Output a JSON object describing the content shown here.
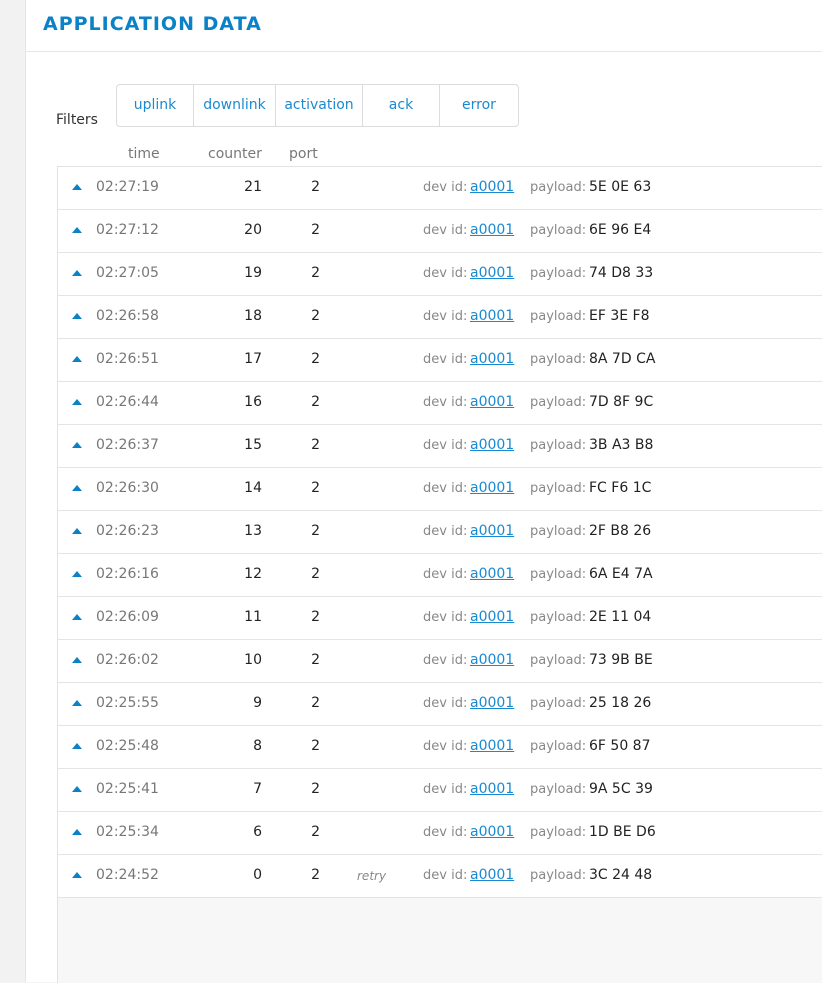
{
  "header": {
    "title": "APPLICATION DATA"
  },
  "filters": {
    "label": "Filters",
    "buttons": [
      {
        "label": "uplink"
      },
      {
        "label": "downlink"
      },
      {
        "label": "activation"
      },
      {
        "label": "ack"
      },
      {
        "label": "error"
      }
    ]
  },
  "columns": {
    "time": "time",
    "counter": "counter",
    "port": "port"
  },
  "labels": {
    "dev_id": "dev id:",
    "payload": "payload:"
  },
  "colors": {
    "accent": "#0b82c8",
    "link": "#1a8ad0"
  },
  "icons": {
    "direction": "uplink-arrow-icon"
  },
  "rows": [
    {
      "time": "02:27:19",
      "counter": "21",
      "port": "2",
      "flag": "",
      "dev_id": "a0001",
      "payload": "5E 0E 63"
    },
    {
      "time": "02:27:12",
      "counter": "20",
      "port": "2",
      "flag": "",
      "dev_id": "a0001",
      "payload": "6E 96 E4"
    },
    {
      "time": "02:27:05",
      "counter": "19",
      "port": "2",
      "flag": "",
      "dev_id": "a0001",
      "payload": "74 D8 33"
    },
    {
      "time": "02:26:58",
      "counter": "18",
      "port": "2",
      "flag": "",
      "dev_id": "a0001",
      "payload": "EF 3E F8"
    },
    {
      "time": "02:26:51",
      "counter": "17",
      "port": "2",
      "flag": "",
      "dev_id": "a0001",
      "payload": "8A 7D CA"
    },
    {
      "time": "02:26:44",
      "counter": "16",
      "port": "2",
      "flag": "",
      "dev_id": "a0001",
      "payload": "7D 8F 9C"
    },
    {
      "time": "02:26:37",
      "counter": "15",
      "port": "2",
      "flag": "",
      "dev_id": "a0001",
      "payload": "3B A3 B8"
    },
    {
      "time": "02:26:30",
      "counter": "14",
      "port": "2",
      "flag": "",
      "dev_id": "a0001",
      "payload": "FC F6 1C"
    },
    {
      "time": "02:26:23",
      "counter": "13",
      "port": "2",
      "flag": "",
      "dev_id": "a0001",
      "payload": "2F B8 26"
    },
    {
      "time": "02:26:16",
      "counter": "12",
      "port": "2",
      "flag": "",
      "dev_id": "a0001",
      "payload": "6A E4 7A"
    },
    {
      "time": "02:26:09",
      "counter": "11",
      "port": "2",
      "flag": "",
      "dev_id": "a0001",
      "payload": "2E 11 04"
    },
    {
      "time": "02:26:02",
      "counter": "10",
      "port": "2",
      "flag": "",
      "dev_id": "a0001",
      "payload": "73 9B BE"
    },
    {
      "time": "02:25:55",
      "counter": "9",
      "port": "2",
      "flag": "",
      "dev_id": "a0001",
      "payload": "25 18 26"
    },
    {
      "time": "02:25:48",
      "counter": "8",
      "port": "2",
      "flag": "",
      "dev_id": "a0001",
      "payload": "6F 50 87"
    },
    {
      "time": "02:25:41",
      "counter": "7",
      "port": "2",
      "flag": "",
      "dev_id": "a0001",
      "payload": "9A 5C 39"
    },
    {
      "time": "02:25:34",
      "counter": "6",
      "port": "2",
      "flag": "",
      "dev_id": "a0001",
      "payload": "1D BE D6"
    },
    {
      "time": "02:24:52",
      "counter": "0",
      "port": "2",
      "flag": "retry",
      "dev_id": "a0001",
      "payload": "3C 24 48"
    }
  ]
}
